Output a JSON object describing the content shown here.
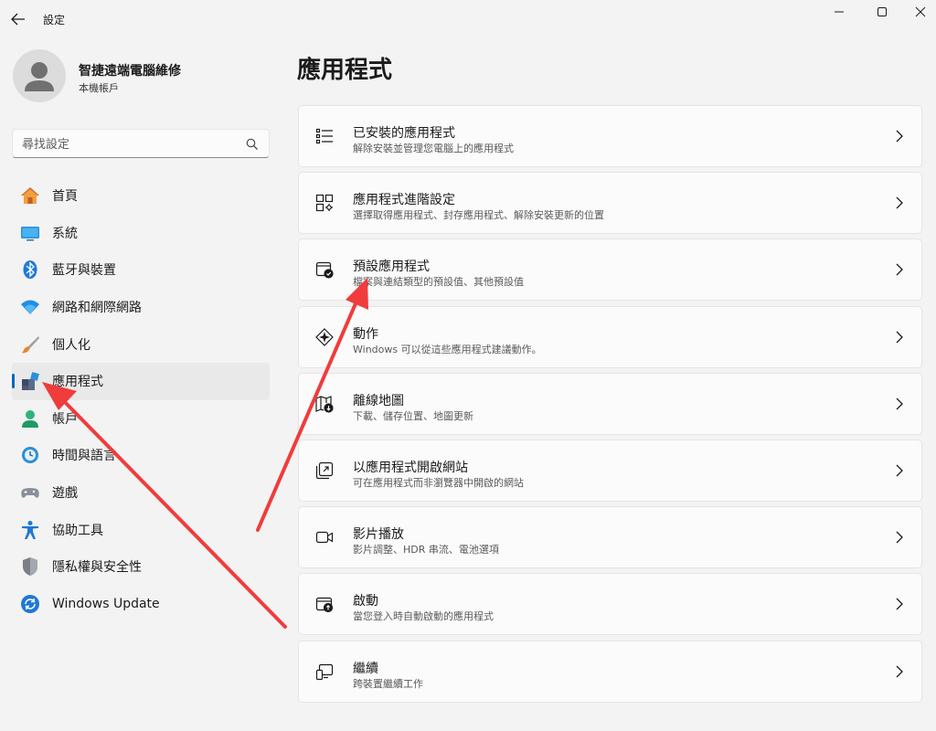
{
  "window": {
    "title": "設定",
    "back_icon": "back-arrow-icon",
    "minimize_icon": "minimize-icon",
    "maximize_icon": "maximize-icon",
    "close_icon": "close-icon"
  },
  "profile": {
    "name": "智捷遠端電腦維修",
    "account_type": "本機帳戶"
  },
  "search": {
    "placeholder": "尋找設定",
    "value": ""
  },
  "sidebar": {
    "items": [
      {
        "label": "首頁",
        "icon": "home-icon",
        "active": false
      },
      {
        "label": "系統",
        "icon": "system-icon",
        "active": false
      },
      {
        "label": "藍牙與裝置",
        "icon": "bluetooth-icon",
        "active": false
      },
      {
        "label": "網路和網際網路",
        "icon": "wifi-icon",
        "active": false
      },
      {
        "label": "個人化",
        "icon": "brush-icon",
        "active": false
      },
      {
        "label": "應用程式",
        "icon": "apps-icon",
        "active": true
      },
      {
        "label": "帳戶",
        "icon": "account-icon",
        "active": false
      },
      {
        "label": "時間與語言",
        "icon": "time-language-icon",
        "active": false
      },
      {
        "label": "遊戲",
        "icon": "gamepad-icon",
        "active": false
      },
      {
        "label": "協助工具",
        "icon": "accessibility-icon",
        "active": false
      },
      {
        "label": "隱私權與安全性",
        "icon": "shield-icon",
        "active": false
      },
      {
        "label": "Windows Update",
        "icon": "windows-update-icon",
        "active": false
      }
    ]
  },
  "main": {
    "title": "應用程式",
    "cards": [
      {
        "title": "已安裝的應用程式",
        "desc": "解除安裝並管理您電腦上的應用程式",
        "icon": "installed-apps-icon"
      },
      {
        "title": "應用程式進階設定",
        "desc": "選擇取得應用程式、封存應用程式、解除安裝更新的位置",
        "icon": "advanced-app-settings-icon"
      },
      {
        "title": "預設應用程式",
        "desc": "檔案與連結類型的預設值、其他預設值",
        "icon": "default-apps-icon"
      },
      {
        "title": "動作",
        "desc": "Windows 可以從這些應用程式建議動作。",
        "icon": "actions-icon"
      },
      {
        "title": "離線地圖",
        "desc": "下載、儲存位置、地圖更新",
        "icon": "offline-maps-icon"
      },
      {
        "title": "以應用程式開啟網站",
        "desc": "可在應用程式而非瀏覽器中開啟的網站",
        "icon": "open-website-icon"
      },
      {
        "title": "影片播放",
        "desc": "影片調整、HDR 串流、電池選項",
        "icon": "video-playback-icon"
      },
      {
        "title": "啟動",
        "desc": "當您登入時自動啟動的應用程式",
        "icon": "startup-icon"
      },
      {
        "title": "繼續",
        "desc": "跨裝置繼續工作",
        "icon": "resume-icon"
      }
    ]
  },
  "colors": {
    "accent": "#0067c0",
    "annotation_arrow": "#f03c3c"
  }
}
